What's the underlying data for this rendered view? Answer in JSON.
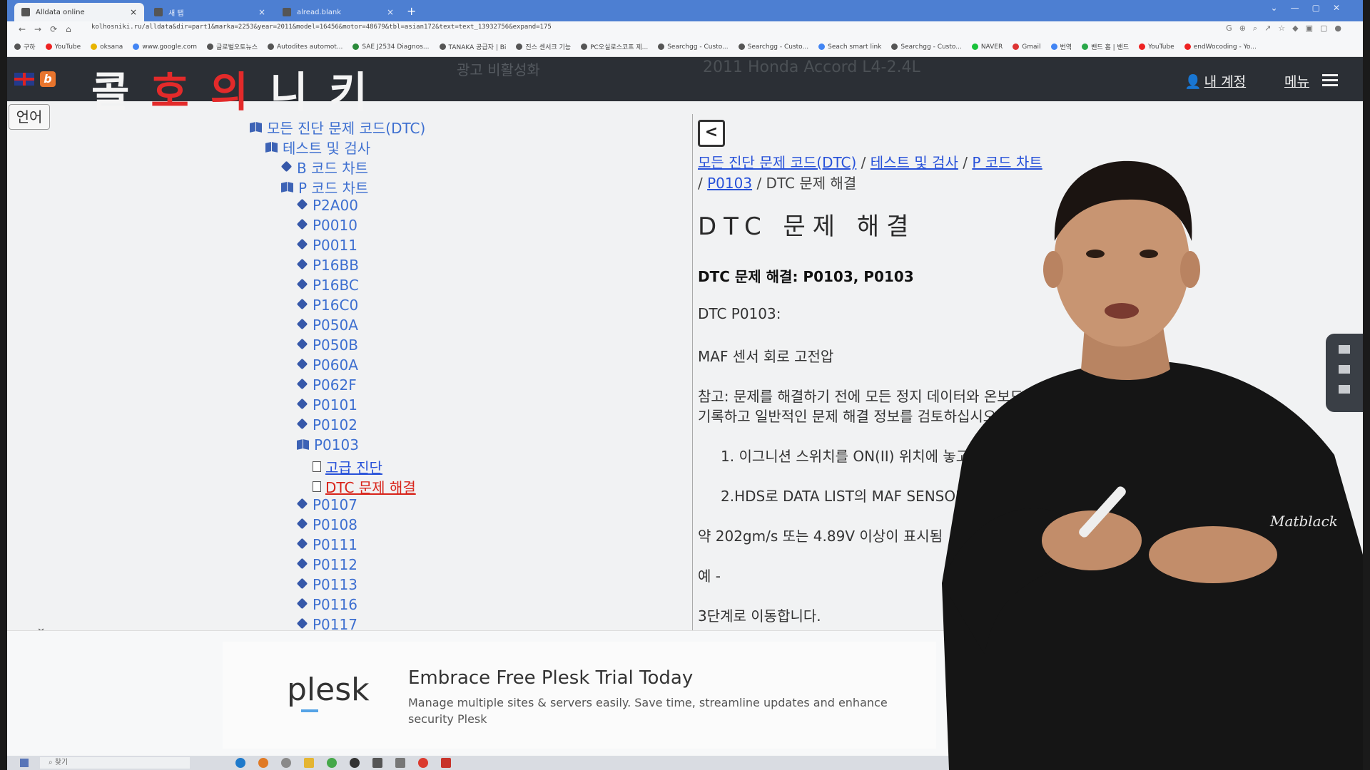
{
  "browser": {
    "tabs": [
      {
        "label": "Alldata online"
      },
      {
        "label": "새 탭"
      },
      {
        "label": "alread.blank"
      }
    ],
    "url": "kolhosniki.ru/alldata&dir=part1&marka=2253&year=2011&model=16456&motor=48679&tbl=asian172&text=text_13932756&expand=175",
    "bookmarks": [
      "구하",
      "YouTube",
      "oksana",
      "www.google.com",
      "글로벌오토뉴스",
      "Autodites automot...",
      "SAE J2534 Diagnos...",
      "TANAKA 공급자 | Bi",
      "진스 센서크 기능",
      "PC오실로스코프 제...",
      "Searchgg - Custo...",
      "Searchgg - Custo...",
      "Seach smart link",
      "Searchgg - Custo...",
      "NAVER",
      "Gmail",
      "번역",
      "밴드 홈 | 밴드",
      "YouTube",
      "endWocoding - Yo..."
    ]
  },
  "site": {
    "logo_chars": [
      "콜",
      "호",
      "의",
      "니",
      "키"
    ],
    "ghost_text": "광고 비활성화",
    "ghost_vehicle": "2011 Honda Accord L4-2.4L",
    "account": "내 계정",
    "menu": "메뉴",
    "lang_button": "언어"
  },
  "tree": {
    "root": "모든 진단 문제 코드(DTC)",
    "level1": "테스트 및 검사",
    "b_chart": "B 코드 차트",
    "p_chart": "P 코드 차트",
    "codes_before": [
      "P2A00",
      "P0010",
      "P0011",
      "P16BB",
      "P16BC",
      "P16C0",
      "P050A",
      "P050B",
      "P060A",
      "P062F",
      "P0101",
      "P0102"
    ],
    "open_code": "P0103",
    "children": [
      "고급 진단",
      "DTC 문제 해결"
    ],
    "codes_after": [
      "P0107",
      "P0108",
      "P0111",
      "P0112",
      "P0113",
      "P0116",
      "P0117"
    ]
  },
  "content": {
    "breadcrumb": [
      "모든 진단 문제 코드(DTC)",
      "테스트 및 검사",
      "P 코드 차트",
      "P0103"
    ],
    "breadcrumb_current": "DTC 문제 해결",
    "sep": "/",
    "heading": "DTC 문제 해결",
    "lines": [
      "DTC 문제 해결: P0103, P0103",
      "DTC P0103:",
      "MAF 센서 회로 고전압",
      "참고: 문제를 해결하기 전에 모든 정지 데이터와 온보드 스",
      "기록하고 일반적인 문제 해결 정보를 검토하십시오.",
      "1. 이그니션 스위치를 ON(II) 위치에 놓고 ",
      "2.HDS로 DATA LIST의 MAF SENSOR",
      "약 202gm/s 또는 4.89V 이상이 표시됨",
      "예 -",
      "3단계로 이동합니다."
    ]
  },
  "ad": {
    "brand": "plesk",
    "title": "Embrace Free Plesk Trial Today",
    "text": "Manage multiple sites & servers easily. Save time, streamline updates and enhance security Plesk"
  },
  "taskbar": {
    "search": "찾기"
  },
  "presenter": {
    "shirt_text": "Matblack"
  }
}
